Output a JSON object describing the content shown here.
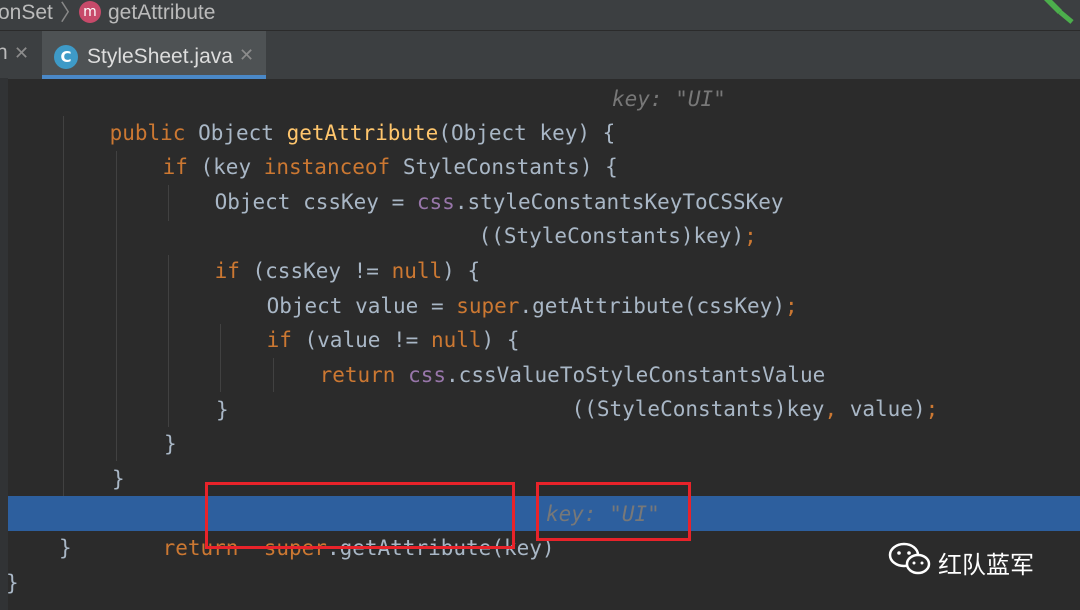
{
  "breadcrumb": {
    "parent": "onSet",
    "separator": "〉",
    "method_icon": "m",
    "method": "getAttribute"
  },
  "tabs": [
    {
      "label": "n",
      "close": "✕"
    },
    {
      "label": "StyleSheet.java",
      "icon": "C",
      "close": "✕",
      "active": true
    }
  ],
  "code": {
    "l1": {
      "kw": "public",
      "t1": " Object ",
      "fn": "getAttribute",
      "t2": "(Object key) {",
      "hint": "key: \"UI\""
    },
    "l2": {
      "kw1": "if",
      "t1": " (key ",
      "kw2": "instanceof",
      "t2": " StyleConstants) {"
    },
    "l3": {
      "t1": "Object cssKey = ",
      "fld": "css",
      "t2": ".styleConstantsKeyToCSSKey"
    },
    "l4": {
      "t1": "((StyleConstants)key)",
      "semi": ";"
    },
    "l5": {
      "kw1": "if",
      "t1": " (cssKey != ",
      "kw2": "null",
      "t2": ") {"
    },
    "l6": {
      "t1": "Object value = ",
      "kw": "super",
      "t2": ".getAttribute(cssKey)",
      "semi": ";"
    },
    "l7": {
      "kw1": "if",
      "t1": " (value != ",
      "kw2": "null",
      "t2": ") {"
    },
    "l8": {
      "kw": "return",
      "fld": "css",
      "t1": ".cssValueToStyleConstantsValue"
    },
    "l9": {
      "t1": "((StyleConstants)key",
      "comma": ",",
      "t2": " value)",
      "semi": ";"
    },
    "l10": "}",
    "l11": "}",
    "l12": "}",
    "l13": {
      "kw": "return",
      "super": "super",
      "t1": ".getAttribute(key)",
      "hint": "key: \"UI\""
    },
    "l14": "}",
    "l15": "}"
  },
  "watermark": {
    "text": "红队蓝军",
    "icon": "wechat-icon"
  },
  "colors": {
    "background": "#2b2b2b",
    "keyword": "#cc7832",
    "method": "#ffc66d",
    "field": "#9876aa",
    "execution_line": "#2d5f9e",
    "annotation_box": "#e8232a"
  }
}
